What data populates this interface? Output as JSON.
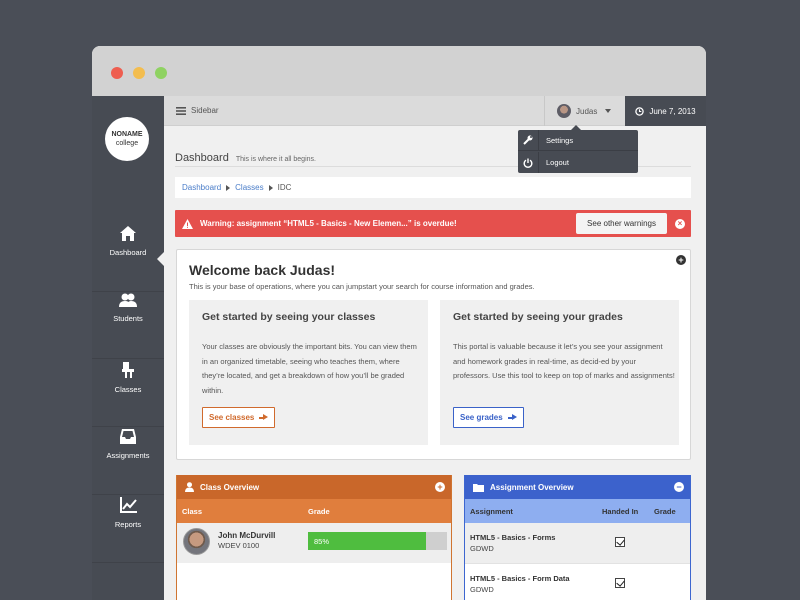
{
  "logo": {
    "line1": "NONAME",
    "line2": "college"
  },
  "sidebar": {
    "items": [
      {
        "label": "Dashboard",
        "icon": "home-icon"
      },
      {
        "label": "Students",
        "icon": "users-icon"
      },
      {
        "label": "Classes",
        "icon": "chalkboard-icon"
      },
      {
        "label": "Assignments",
        "icon": "inbox-icon"
      },
      {
        "label": "Reports",
        "icon": "chart-icon"
      }
    ]
  },
  "topbar": {
    "toggle_label": "Sidebar",
    "user_name": "Judas",
    "date": "June 7, 2013"
  },
  "user_dropdown": {
    "items": [
      {
        "label": "Settings",
        "icon": "wrench-icon"
      },
      {
        "label": "Logout",
        "icon": "power-icon"
      }
    ]
  },
  "page": {
    "title": "Dashboard",
    "subtitle": "This is where it all begins."
  },
  "breadcrumb": {
    "items": [
      "Dashboard",
      "Classes",
      "IDC"
    ]
  },
  "alert": {
    "text": "Warning: assignment “HTML5 - Basics - New Elemen...” is overdue!",
    "button": "See other warnings",
    "close": "×"
  },
  "welcome": {
    "title": "Welcome back Judas!",
    "intro": "This is your base of operations, where you can jumpstart your search for course information and grades.",
    "toggle": "+",
    "cards": [
      {
        "title": "Get started by seeing your classes",
        "body": "Your classes are obviously the important bits. You can view them in an organized timetable, seeing who teaches them, where they’re located, and get a breakdown of how you’ll be graded within.",
        "button": "See classes"
      },
      {
        "title": "Get started by seeing your grades",
        "body": "This portal is valuable because it let’s you see your assignment and homework grades in real-time, as decid-ed by your professors. Use this tool to keep on top of marks and assignments!",
        "button": "See grades"
      }
    ]
  },
  "class_overview": {
    "title": "Class Overview",
    "toggle": "+",
    "columns": [
      "Class",
      "Grade"
    ],
    "rows": [
      {
        "name": "John McDurvill",
        "code": "WDEV 0100",
        "grade_label": "85%",
        "grade": 0.85
      }
    ]
  },
  "assignment_overview": {
    "title": "Assignment Overview",
    "toggle": "−",
    "columns": [
      "Assignment",
      "Handed In",
      "Grade"
    ],
    "rows": [
      {
        "name": "HTML5 - Basics - Forms",
        "course": "GDWD",
        "handed_in": true
      },
      {
        "name": "HTML5 - Basics - Form Data",
        "course": "GDWD",
        "handed_in": true
      }
    ]
  },
  "colors": {
    "alert": "#e5504d",
    "class_accent": "#c9672a",
    "assignment_accent": "#3c62cc",
    "progress": "#4fbd3f",
    "sidebar": "#474b53"
  }
}
